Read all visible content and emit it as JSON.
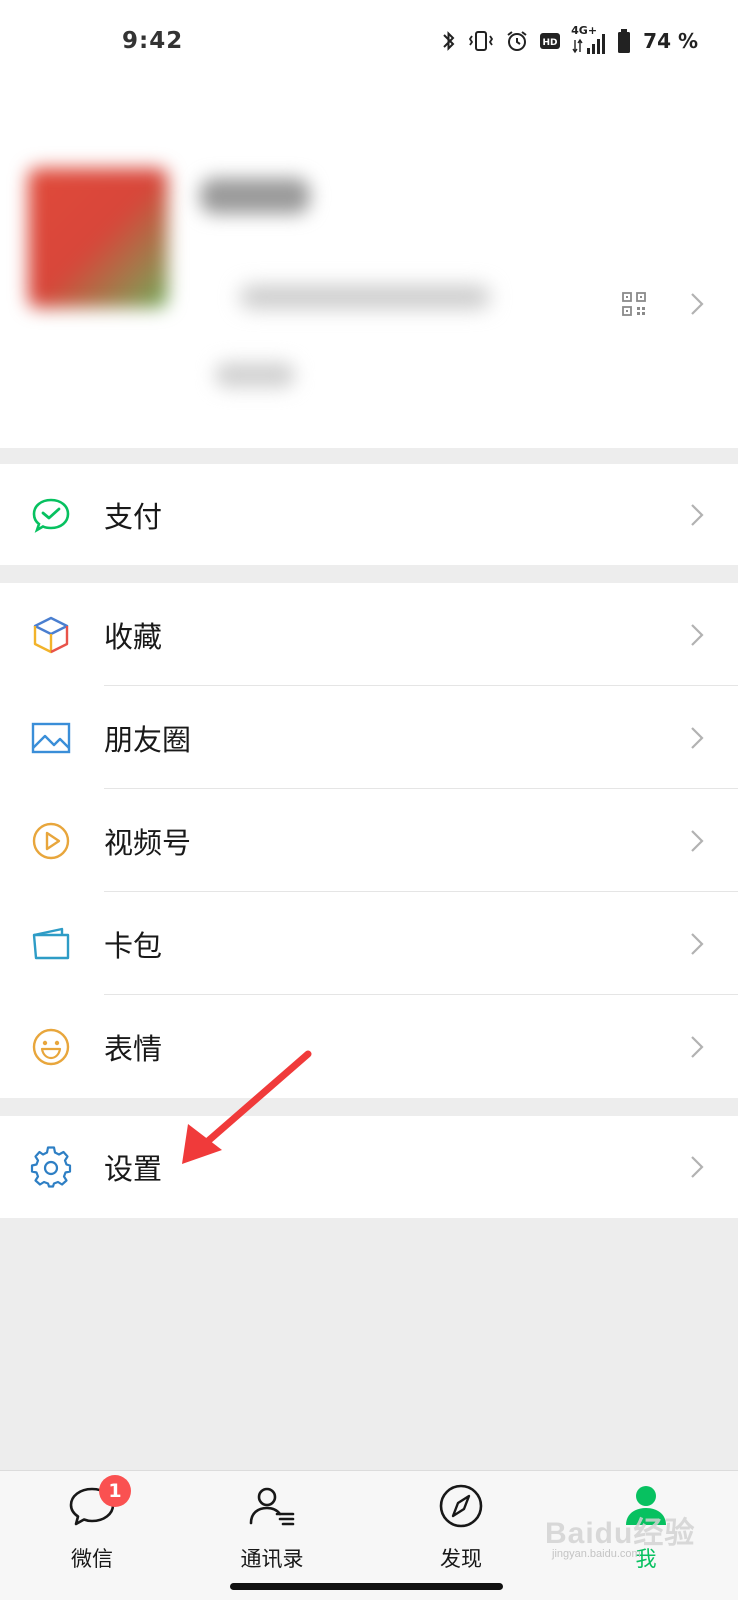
{
  "status_bar": {
    "time": "9:42",
    "network": "4G+",
    "battery": "74 %"
  },
  "profile": {
    "icons": [
      "qr-code-icon",
      "chevron-right-icon"
    ]
  },
  "menu": {
    "pay": "支付",
    "favorites": "收藏",
    "moments": "朋友圈",
    "channels": "视频号",
    "cards": "卡包",
    "stickers": "表情",
    "settings": "设置"
  },
  "colors": {
    "accent_green": "#07c160",
    "badge_red": "#fa5151",
    "annotation_red": "#f03a3a"
  },
  "tabbar": {
    "chats": "微信",
    "chats_badge": "1",
    "contacts": "通讯录",
    "discover": "发现",
    "me": "我"
  },
  "watermark": {
    "brand": "Baidu经验",
    "url": "jingyan.baidu.com"
  }
}
